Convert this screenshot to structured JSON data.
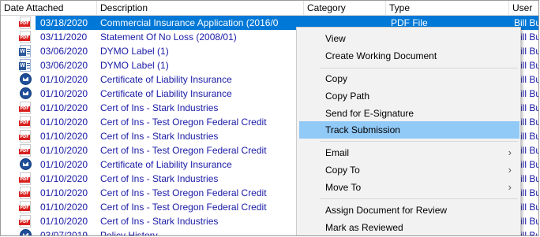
{
  "columns": {
    "date": "Date Attached",
    "description": "Description",
    "category": "Category",
    "type": "Type",
    "user": "User"
  },
  "rows": [
    {
      "date": "03/18/2020",
      "description": "Commercial Insurance Application (2016/0",
      "type": "PDF File",
      "user": "Bill Bu",
      "icon": "pdf-icon",
      "selected": true
    },
    {
      "date": "03/11/2020",
      "description": "Statement Of No Loss (2008/01)",
      "type": "",
      "user": "Bill Bu",
      "icon": "pdf-icon"
    },
    {
      "date": "03/06/2020",
      "description": "DYMO Label (1)",
      "type": "",
      "user": "Bill Bu",
      "icon": "word-icon"
    },
    {
      "date": "03/06/2020",
      "description": "DYMO Label (1)",
      "type": "",
      "user": "Bill Bu",
      "icon": "word-icon"
    },
    {
      "date": "01/10/2020",
      "description": "Certificate of Liability Insurance",
      "type": "",
      "user": "Bill Bu",
      "icon": "email-icon"
    },
    {
      "date": "01/10/2020",
      "description": "Certificate of Liability Insurance",
      "type": "",
      "user": "Bill Bu",
      "icon": "email-icon"
    },
    {
      "date": "01/10/2020",
      "description": "Cert of Ins - Stark Industries",
      "type": "",
      "user": "Bill Bu",
      "icon": "pdf-icon"
    },
    {
      "date": "01/10/2020",
      "description": "Cert of Ins - Test Oregon Federal Credit",
      "type": "",
      "user": "Bill Bu",
      "icon": "pdf-icon"
    },
    {
      "date": "01/10/2020",
      "description": "Cert of Ins - Stark Industries",
      "type": "",
      "user": "Bill Bu",
      "icon": "pdf-icon"
    },
    {
      "date": "01/10/2020",
      "description": "Cert of Ins - Test Oregon Federal Credit",
      "type": "",
      "user": "Bill Bu",
      "icon": "pdf-icon"
    },
    {
      "date": "01/10/2020",
      "description": "Certificate of Liability Insurance",
      "type": "",
      "user": "Bill Bu",
      "icon": "email-icon"
    },
    {
      "date": "01/10/2020",
      "description": "Cert of Ins - Stark Industries",
      "type": "",
      "user": "Bill Bu",
      "icon": "pdf-icon"
    },
    {
      "date": "01/10/2020",
      "description": "Cert of Ins - Test Oregon Federal Credit",
      "type": "",
      "user": "Bill Bu",
      "icon": "pdf-icon"
    },
    {
      "date": "01/10/2020",
      "description": "Cert of Ins - Test Oregon Federal Credit",
      "type": "",
      "user": "Bill Bu",
      "icon": "pdf-icon"
    },
    {
      "date": "01/10/2020",
      "description": "Cert of Ins - Stark Industries",
      "type": "",
      "user": "Bill Bu",
      "icon": "pdf-icon"
    },
    {
      "date": "03/07/2019",
      "description": "Policy History",
      "type": "",
      "user": "Bill Bu",
      "icon": "email-icon"
    }
  ],
  "icon_labels": {
    "pdf": "PDF",
    "word": "W"
  },
  "context_menu": {
    "items": [
      {
        "label": "View",
        "submenu": false
      },
      {
        "label": "Create Working Document",
        "submenu": false
      },
      {
        "label": "Copy",
        "submenu": false
      },
      {
        "label": "Copy Path",
        "submenu": false
      },
      {
        "label": "Send for E-Signature",
        "submenu": false
      },
      {
        "label": "Track Submission",
        "submenu": false,
        "highlighted": true
      },
      {
        "label": "Email",
        "submenu": true
      },
      {
        "label": "Copy To",
        "submenu": true
      },
      {
        "label": "Move To",
        "submenu": true
      },
      {
        "label": "Assign Document for Review",
        "submenu": false
      },
      {
        "label": "Mark as Reviewed",
        "submenu": false
      }
    ],
    "submenu_arrow": "›"
  },
  "colors": {
    "selection": "#0078d7",
    "menu_highlight": "#91c9f7",
    "link_text": "#1a1aa6"
  }
}
